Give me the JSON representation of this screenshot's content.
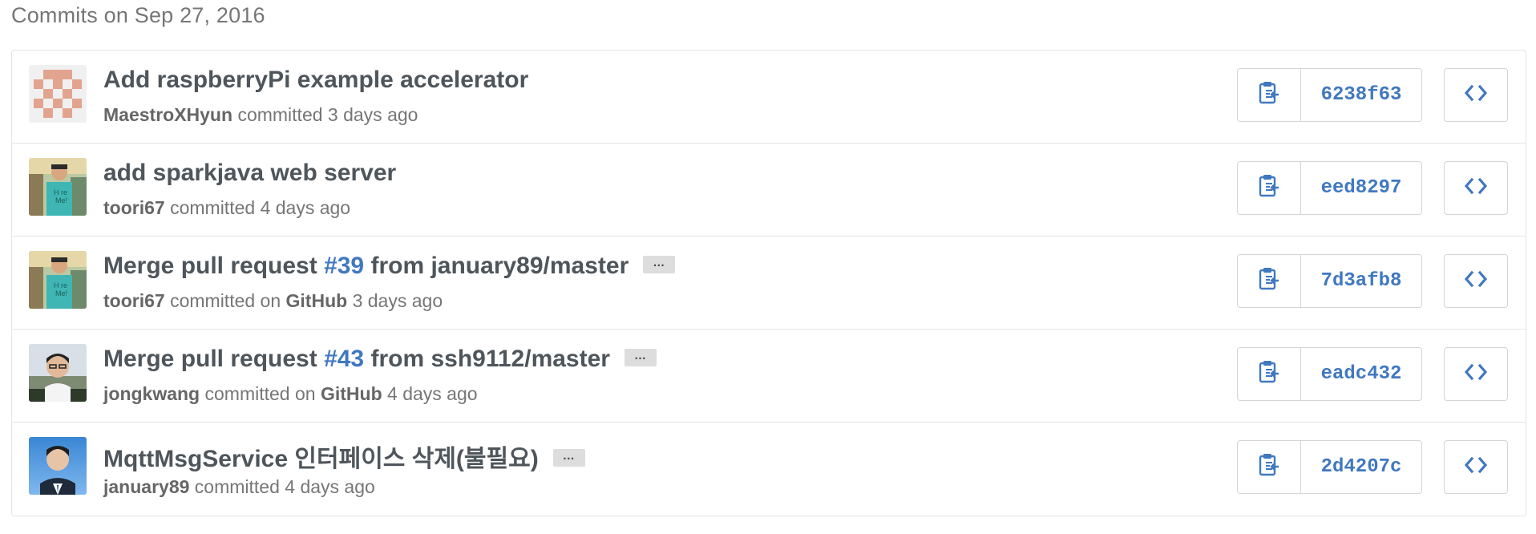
{
  "day_title": "Commits on Sep 27, 2016",
  "commits": [
    {
      "message_pre": "Add raspberryPi example accelerator",
      "issue": "",
      "message_post": "",
      "author": "MaestroXHyun",
      "committed_on": "",
      "github": "",
      "time": "3 days ago",
      "sha": "6238f63",
      "ellipsis": ""
    },
    {
      "message_pre": "add sparkjava web server",
      "issue": "",
      "message_post": "",
      "author": "toori67",
      "committed_on": "committed",
      "github": "",
      "time": "4 days ago",
      "sha": "eed8297",
      "ellipsis": ""
    },
    {
      "message_pre": "Merge pull request ",
      "issue": "#39",
      "message_post": " from january89/master",
      "author": "toori67",
      "committed_on": "committed on",
      "github": "GitHub",
      "time": "3 days ago",
      "sha": "7d3afb8",
      "ellipsis": "…"
    },
    {
      "message_pre": "Merge pull request ",
      "issue": "#43",
      "message_post": " from ssh9112/master",
      "author": "jongkwang",
      "committed_on": "committed on",
      "github": "GitHub",
      "time": "4 days ago",
      "sha": "eadc432",
      "ellipsis": "…"
    },
    {
      "message_pre": "MqttMsgService 인터페이스 삭제(불필요)",
      "issue": "",
      "message_post": "",
      "author": "january89",
      "committed_on": "committed",
      "github": "",
      "time": "4 days ago",
      "sha": "2d4207c",
      "ellipsis": "…"
    }
  ],
  "committed_word": "committed",
  "icons": {
    "copy": "clipboard-icon",
    "browse": "code-icon"
  },
  "colors": {
    "link": "#4078c0",
    "text": "#4e555b",
    "muted": "#767676",
    "border": "#e1e4e8"
  }
}
